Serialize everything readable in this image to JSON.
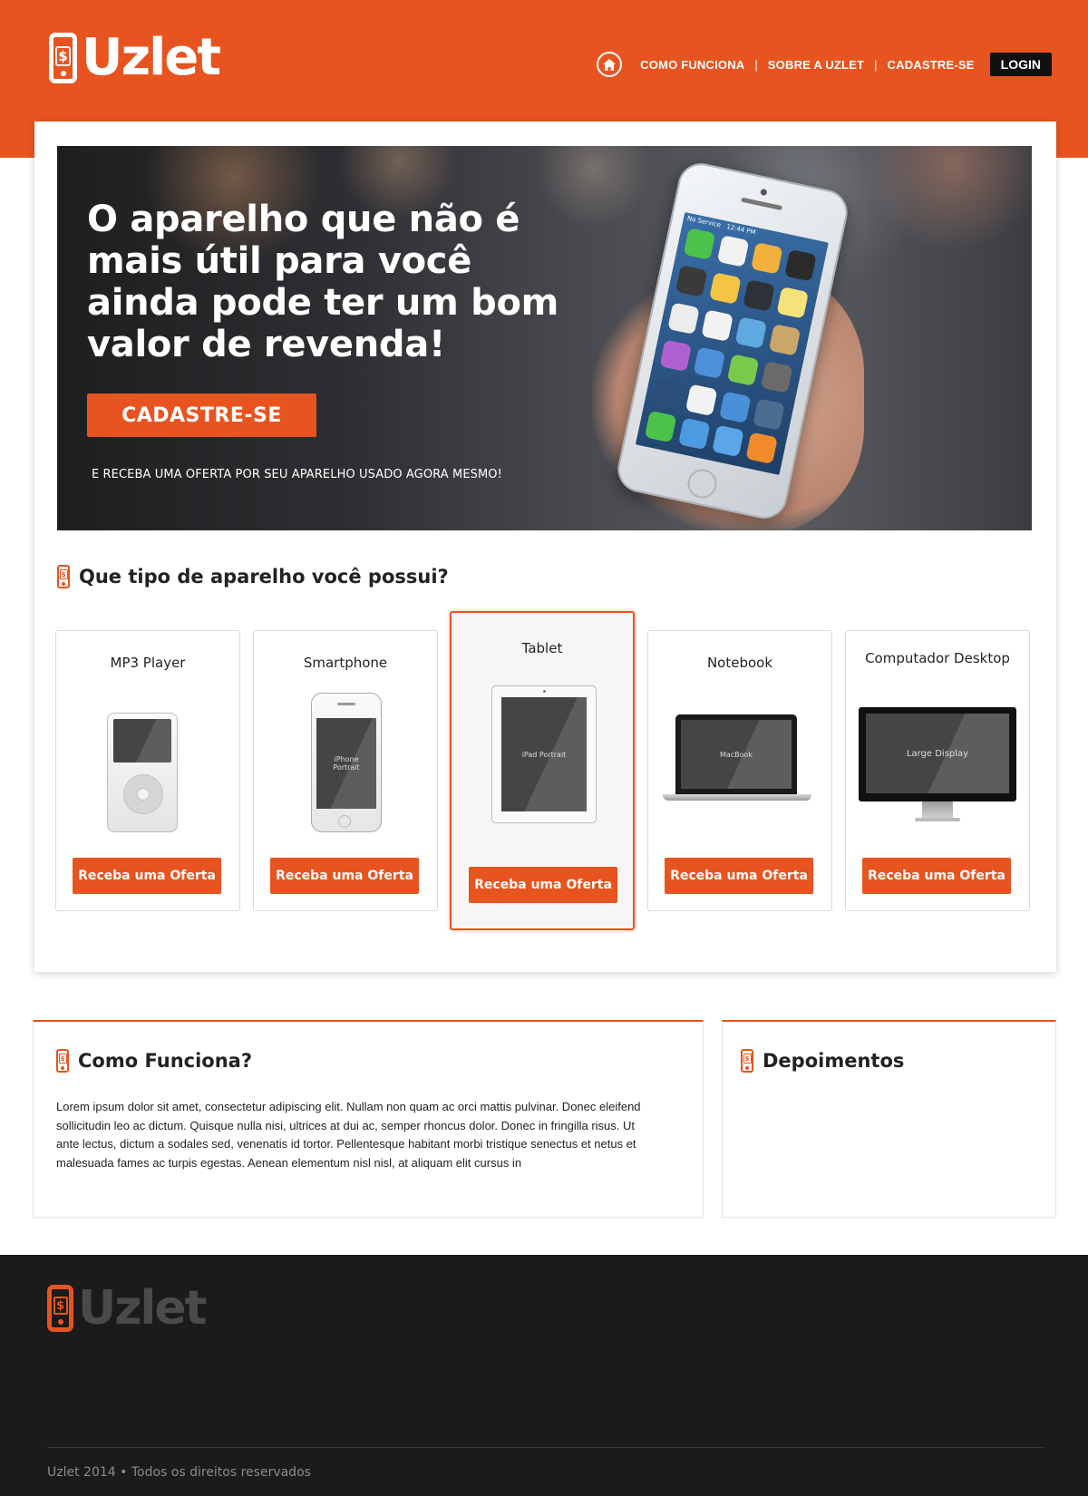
{
  "brand": {
    "name": "Uzlet",
    "accent": "#e8541f",
    "dark": "#1b1b1c"
  },
  "nav": {
    "home_icon": "home-icon",
    "items": [
      "COMO FUNCIONA",
      "SOBRE A UZLET",
      "CADASTRE-SE"
    ],
    "login": "LOGIN"
  },
  "hero": {
    "title": "O aparelho que não é mais útil para você ainda pode ter um bom valor de revenda!",
    "cta": "CADASTRE-SE",
    "subtitle": "E RECEBA UMA OFERTA POR SEU APARELHO USADO AGORA MESMO!",
    "phone_status": "No Service",
    "phone_time": "12:44 PM"
  },
  "devices": {
    "title": "Que tipo de aparelho você possui?",
    "items": [
      {
        "name": "MP3 Player",
        "button": "Receba uma Oferta",
        "screen": ""
      },
      {
        "name": "Smartphone",
        "button": "Receba uma Oferta",
        "screen": "iPhone Portrait"
      },
      {
        "name": "Tablet",
        "button": "Receba uma Oferta",
        "screen": "iPad Portrait"
      },
      {
        "name": "Notebook",
        "button": "Receba uma Oferta",
        "screen": "MacBook"
      },
      {
        "name": "Computador Desktop",
        "button": "Receba uma Oferta",
        "screen": "Large Display"
      }
    ],
    "selected": "Tablet"
  },
  "how": {
    "title": "Como Funciona?",
    "text": "Lorem ipsum dolor sit amet, consectetur adipiscing elit. Nullam non quam ac orci mattis pulvinar. Donec eleifend sollicitudin leo ac dictum. Quisque nulla nisi, ultrices at dui ac, semper rhoncus dolor. Donec in fringilla risus. Ut ante lectus, dictum a sodales sed, venenatis id tortor. Pellentesque habitant morbi tristique senectus et netus et malesuada fames ac turpis egestas. Aenean elementum nisl nisl, at aliquam elit cursus in"
  },
  "testimonials": {
    "title": "Depoimentos"
  },
  "footer": {
    "logo": "Uzlet",
    "copyright": "Uzlet 2014 • Todos os direitos reservados"
  }
}
